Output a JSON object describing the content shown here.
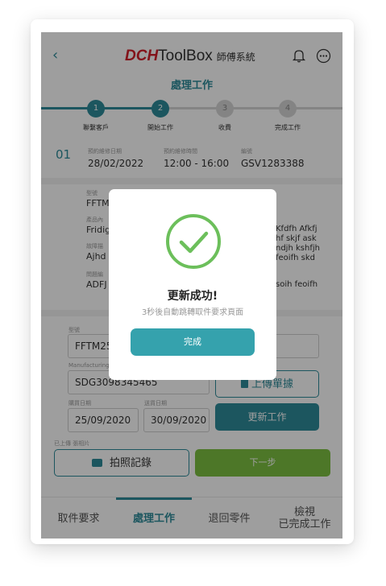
{
  "header": {
    "brand_bold": "DCH",
    "brand_name": "ToolBox",
    "brand_sub": "師傅系統",
    "back_icon": "chevron-left-icon",
    "notifications_icon": "bell-icon",
    "menu_icon": "more-dots-icon"
  },
  "page_title": "處理工作",
  "stepper": {
    "steps": [
      {
        "num": "1",
        "label": "聯繫客戶",
        "active": true
      },
      {
        "num": "2",
        "label": "開始工作",
        "active": true
      },
      {
        "num": "3",
        "label": "收費",
        "active": false
      },
      {
        "num": "4",
        "label": "完成工作",
        "active": false
      }
    ]
  },
  "job": {
    "number": "01",
    "date_label": "預約維修日期",
    "date": "28/02/2022",
    "time_label": "預約維修時間",
    "time": "12:00 - 16:00",
    "code_label": "編號",
    "code": "GSV1283388"
  },
  "product": {
    "model_label": "型號",
    "model": "FFTM",
    "item_label": "產品內",
    "item": "Fridig",
    "issue_label": "故障描",
    "issue": "Ajhd",
    "note_label": "問題編",
    "note": "ADFJ",
    "desc_lines": [
      "Kfdfh Afkfj",
      "hf skjf ask",
      "ndjh kshfjh",
      "feoifh skd"
    ],
    "desc_tail": "soih feoifh"
  },
  "form": {
    "model_label": "型號",
    "model_value": "FFTM25S",
    "serial_label": "Manufacturing",
    "serial_value": "SDG3098345465",
    "upload_button": "上傳單據",
    "buy_date_label": "購買日期",
    "buy_date": "25/09/2020",
    "ship_date_label": "送貨日期",
    "ship_date": "30/09/2020",
    "update_button": "更新工作",
    "photo_label": "已上傳 張相片",
    "photo_button": "拍照記錄",
    "next_button": "下一步"
  },
  "tabs": [
    {
      "label": "取件要求",
      "active": false
    },
    {
      "label": "處理工作",
      "active": true
    },
    {
      "label": "退回零件",
      "active": false
    },
    {
      "label_line1": "檢視",
      "label_line2": "已完成工作",
      "active": false
    }
  ],
  "modal": {
    "icon": "check-circle-icon",
    "title": "更新成功!",
    "message": "3秒後自動跳轉取件要求頁面",
    "button": "完成"
  },
  "colors": {
    "accent": "#2e8b99",
    "brand_red": "#d4202a",
    "success_green": "#7cc142",
    "check_green": "#6cbf5b"
  }
}
